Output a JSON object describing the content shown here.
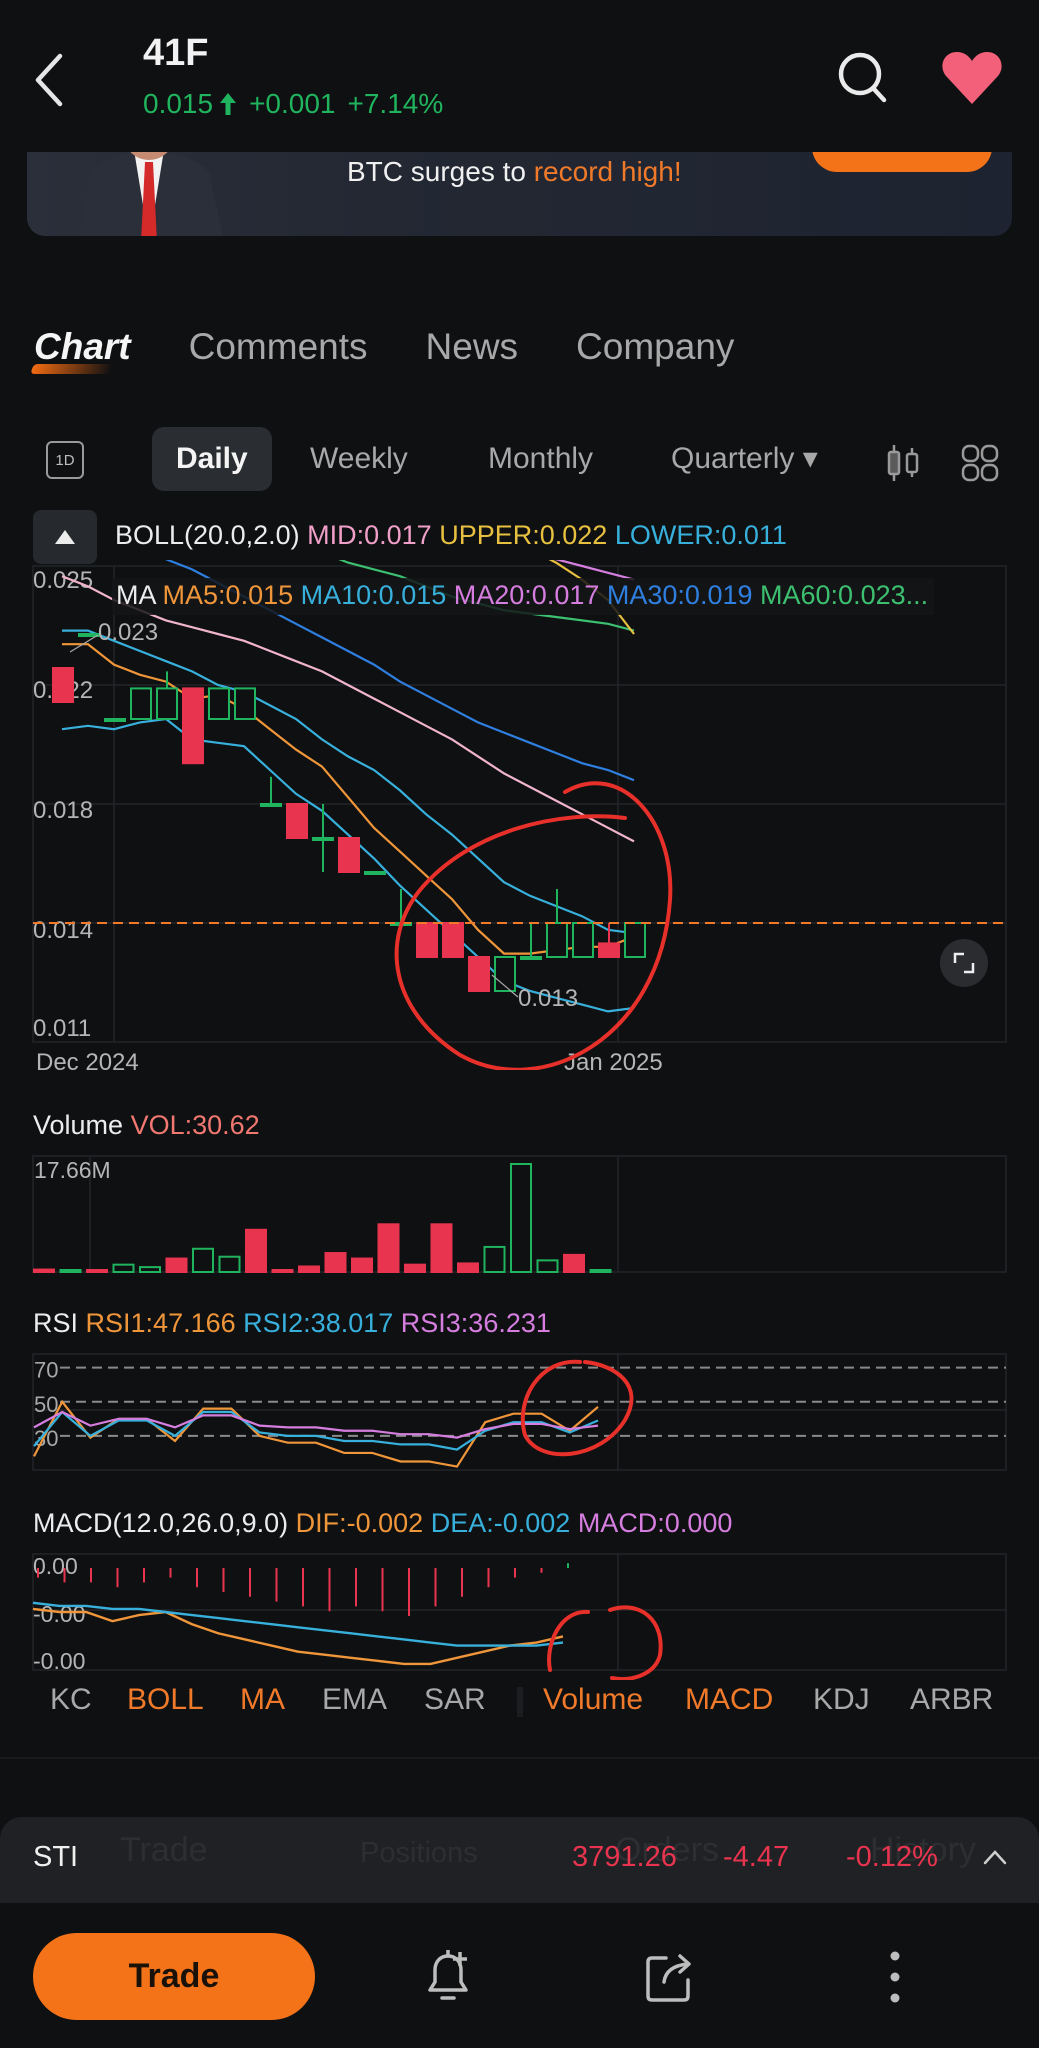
{
  "header": {
    "ticker": "41F",
    "price": "0.015",
    "direction_icon": "arrow-up-icon",
    "change": "+0.001",
    "change_pct": "+7.14%",
    "up_color": "#1fb45d",
    "favorite_color": "#f2607a"
  },
  "banner": {
    "text_plain": "BTC surges to ",
    "text_highlight": "record high!",
    "highlight_color": "#f07a2a"
  },
  "tabs": [
    {
      "label": "Chart",
      "active": true
    },
    {
      "label": "Comments",
      "active": false
    },
    {
      "label": "News",
      "active": false
    },
    {
      "label": "Company",
      "active": false
    }
  ],
  "periods": {
    "intraday_icon_label": "1D",
    "items": [
      {
        "label": "Daily",
        "active": true
      },
      {
        "label": "Weekly",
        "active": false
      },
      {
        "label": "Monthly",
        "active": false
      },
      {
        "label": "Quarterly ▾",
        "active": false
      }
    ]
  },
  "legends": {
    "boll": {
      "name": "BOLL(20.0,2.0)",
      "mid": "MID:0.017",
      "upper": "UPPER:0.022",
      "lower": "LOWER:0.011"
    },
    "ma": {
      "name": "MA",
      "ma5": "MA5:0.015",
      "ma10": "MA10:0.015",
      "ma20": "MA20:0.017",
      "ma30": "MA30:0.019",
      "ma60": "MA60:0.023..."
    },
    "volume": {
      "name": "Volume",
      "vol": "VOL:30.62"
    },
    "rsi": {
      "name": "RSI",
      "rsi1": "RSI1:47.166",
      "rsi2": "RSI2:38.017",
      "rsi3": "RSI3:36.231"
    },
    "macd": {
      "name": "MACD(12.0,26.0,9.0)",
      "dif": "DIF:-0.002",
      "dea": "DEA:-0.002",
      "macd": "MACD:0.000"
    }
  },
  "colors": {
    "up": "#1fb45d",
    "down": "#e8344e",
    "ma5": "#f0963a",
    "ma10": "#38b0dc",
    "ma20": "#d67ee0",
    "ma30": "#2f7fe0",
    "ma60": "#3cc070",
    "boll_mid": "#f0b4cc",
    "boll_upper": "#e8c040",
    "boll_lower": "#38b0dc",
    "last_price_line": "#f07a2a",
    "annotation": "#e8302a"
  },
  "chart_data": [
    {
      "type": "candlestick",
      "title": "41F Daily",
      "y_ticks": [
        "0.025",
        "0.022",
        "0.018",
        "0.014",
        "0.011"
      ],
      "ylim": [
        0.011,
        0.025
      ],
      "x_labels": [
        "Dec 2024",
        "Jan 2025"
      ],
      "high_label": "0.023",
      "low_label": "0.013",
      "last_price": 0.0145,
      "candles": [
        {
          "o": 0.022,
          "h": 0.022,
          "l": 0.021,
          "c": 0.021
        },
        {
          "o": 0.023,
          "h": 0.023,
          "l": 0.023,
          "c": 0.023
        },
        {
          "o": 0.0205,
          "h": 0.0205,
          "l": 0.0205,
          "c": 0.0205
        },
        {
          "o": 0.0205,
          "h": 0.0214,
          "l": 0.0205,
          "c": 0.0214
        },
        {
          "o": 0.0205,
          "h": 0.0219,
          "l": 0.0205,
          "c": 0.0214
        },
        {
          "o": 0.0214,
          "h": 0.0214,
          "l": 0.0192,
          "c": 0.0192
        },
        {
          "o": 0.0205,
          "h": 0.0214,
          "l": 0.0205,
          "c": 0.0214
        },
        {
          "o": 0.0205,
          "h": 0.0214,
          "l": 0.0205,
          "c": 0.0214
        },
        {
          "o": 0.018,
          "h": 0.0188,
          "l": 0.018,
          "c": 0.018
        },
        {
          "o": 0.018,
          "h": 0.018,
          "l": 0.017,
          "c": 0.017
        },
        {
          "o": 0.017,
          "h": 0.018,
          "l": 0.016,
          "c": 0.017
        },
        {
          "o": 0.017,
          "h": 0.017,
          "l": 0.016,
          "c": 0.016
        },
        {
          "o": 0.016,
          "h": 0.016,
          "l": 0.016,
          "c": 0.016
        },
        {
          "o": 0.0145,
          "h": 0.0155,
          "l": 0.0145,
          "c": 0.0145
        },
        {
          "o": 0.0145,
          "h": 0.0145,
          "l": 0.0135,
          "c": 0.0135
        },
        {
          "o": 0.0145,
          "h": 0.0145,
          "l": 0.0135,
          "c": 0.0135
        },
        {
          "o": 0.0135,
          "h": 0.0135,
          "l": 0.0125,
          "c": 0.0125
        },
        {
          "o": 0.0125,
          "h": 0.0135,
          "l": 0.0125,
          "c": 0.0135
        },
        {
          "o": 0.0135,
          "h": 0.0145,
          "l": 0.0135,
          "c": 0.0135
        },
        {
          "o": 0.0135,
          "h": 0.0155,
          "l": 0.0135,
          "c": 0.0145
        },
        {
          "o": 0.0135,
          "h": 0.0145,
          "l": 0.0135,
          "c": 0.0145
        },
        {
          "o": 0.0139,
          "h": 0.0145,
          "l": 0.0135,
          "c": 0.0135
        },
        {
          "o": 0.0135,
          "h": 0.0145,
          "l": 0.0135,
          "c": 0.0145
        }
      ],
      "series": [
        {
          "name": "MA5",
          "color_key": "ma5",
          "values": [
            0.0227,
            0.0227,
            0.0221,
            0.0218,
            0.0216,
            0.0211,
            0.0212,
            0.0208,
            0.0202,
            0.0196,
            0.0191,
            0.0182,
            0.0173,
            0.0166,
            0.0159,
            0.0152,
            0.0143,
            0.0136,
            0.0136,
            0.0137,
            0.0138,
            0.0138,
            0.0141
          ]
        },
        {
          "name": "BOLL-UPPER-MA10",
          "color_key": "ma10",
          "values": [
            0.0231,
            0.0231,
            0.0228,
            0.0225,
            0.0222,
            0.0219,
            0.0215,
            0.0213,
            0.0209,
            0.0205,
            0.0199,
            0.0194,
            0.019,
            0.0184,
            0.0177,
            0.0171,
            0.0164,
            0.0157,
            0.0153,
            0.015,
            0.0147,
            0.0143,
            0.0142
          ]
        },
        {
          "name": "BOLL-LOWER",
          "color_key": "boll_lower",
          "values": [
            0.0202,
            0.0203,
            0.0202,
            0.0204,
            0.0205,
            0.0199,
            0.0198,
            0.0197,
            0.019,
            0.0183,
            0.0178,
            0.0171,
            0.0164,
            0.0156,
            0.0149,
            0.0142,
            0.0135,
            0.0128,
            0.0125,
            0.0123,
            0.0121,
            0.0119,
            0.012
          ]
        },
        {
          "name": "BOLL-MID",
          "color_key": "boll_mid",
          "values": [
            0.0247,
            0.0244,
            0.024,
            0.0237,
            0.0234,
            0.0232,
            0.023,
            0.0228,
            0.0225,
            0.0222,
            0.0219,
            0.0215,
            0.0211,
            0.0207,
            0.0203,
            0.0199,
            0.0194,
            0.0189,
            0.0185,
            0.0181,
            0.0177,
            0.0173,
            0.0169
          ]
        },
        {
          "name": "MA30",
          "color_key": "ma30",
          "values": [
            null,
            null,
            null,
            null,
            0.0252,
            0.0249,
            0.0245,
            0.0241,
            0.0237,
            0.0233,
            0.0229,
            0.0225,
            0.0221,
            0.0216,
            0.0212,
            0.0208,
            0.0204,
            0.0201,
            0.0198,
            0.0195,
            0.0192,
            0.019,
            0.0187
          ]
        },
        {
          "name": "MA60",
          "color_key": "ma60",
          "values": [
            null,
            null,
            null,
            null,
            null,
            null,
            null,
            null,
            null,
            null,
            0.0254,
            0.0251,
            0.0249,
            0.0247,
            0.0244,
            0.0241,
            0.0239,
            0.0237,
            0.0236,
            0.0235,
            0.0234,
            0.0233,
            0.0231
          ]
        },
        {
          "name": "BOLL-UPPER",
          "color_key": "boll_upper",
          "values": [
            null,
            null,
            null,
            null,
            null,
            null,
            null,
            null,
            null,
            null,
            null,
            null,
            null,
            null,
            null,
            null,
            null,
            null,
            0.0255,
            0.0251,
            0.0246,
            0.024,
            0.023
          ]
        },
        {
          "name": "MA20",
          "color_key": "ma20",
          "values": [
            null,
            null,
            null,
            null,
            null,
            null,
            null,
            null,
            null,
            null,
            null,
            null,
            null,
            null,
            null,
            null,
            null,
            null,
            0.0254,
            0.0252,
            0.025,
            0.0248,
            0.0246
          ]
        }
      ]
    },
    {
      "type": "bar",
      "title": "Volume",
      "y_max_label": "17.66M",
      "ylim": [
        0,
        17.66
      ],
      "values": [
        0.4,
        0.3,
        0.1,
        1.2,
        0.8,
        2.2,
        3.8,
        2.5,
        6.9,
        0.3,
        0.9,
        3.1,
        2.2,
        7.8,
        1.2,
        7.8,
        1.4,
        4.1,
        17.66,
        1.9,
        2.8,
        0.3
      ],
      "up": [
        false,
        true,
        false,
        true,
        true,
        false,
        true,
        true,
        false,
        false,
        false,
        false,
        false,
        false,
        false,
        false,
        false,
        true,
        true,
        true,
        false,
        true
      ]
    },
    {
      "type": "line",
      "title": "RSI",
      "y_ticks": [
        "70",
        "50",
        "30"
      ],
      "ylim": [
        10,
        78
      ],
      "series": [
        {
          "name": "RSI1",
          "color_key": "ma5",
          "values": [
            18,
            50,
            29,
            40,
            40,
            27,
            46,
            46,
            30,
            26,
            26,
            20,
            20,
            15,
            15,
            12,
            38,
            43,
            43,
            33,
            47
          ]
        },
        {
          "name": "RSI2",
          "color_key": "ma10",
          "values": [
            24,
            44,
            30,
            39,
            39,
            30,
            44,
            44,
            32,
            30,
            30,
            27,
            27,
            25,
            25,
            22,
            33,
            38,
            38,
            32,
            39
          ]
        },
        {
          "name": "RSI3",
          "color_key": "ma20",
          "values": [
            35,
            44,
            36,
            40,
            40,
            35,
            42,
            42,
            36,
            35,
            35,
            33,
            33,
            31,
            31,
            29,
            34,
            37,
            37,
            34,
            36
          ]
        }
      ]
    },
    {
      "type": "line",
      "title": "MACD",
      "y_ticks": [
        "0.00",
        "-0.00",
        "-0.00"
      ],
      "ylim": [
        -0.0034,
        0.0004
      ],
      "histogram": [
        -0.0002,
        -0.0003,
        -0.0003,
        -0.0004,
        -0.0003,
        -0.0002,
        -0.0004,
        -0.0005,
        -0.0006,
        -0.0007,
        -0.0008,
        -0.0009,
        -0.0008,
        -0.0009,
        -0.001,
        -0.0008,
        -0.0006,
        -0.0004,
        -0.0002,
        -0.0001,
        0.0001
      ],
      "series": [
        {
          "name": "DIF",
          "color_key": "ma5",
          "values": [
            -0.0014,
            -0.0015,
            -0.0015,
            -0.0018,
            -0.0016,
            -0.0015,
            -0.0019,
            -0.0022,
            -0.0024,
            -0.0026,
            -0.0028,
            -0.0029,
            -0.003,
            -0.0031,
            -0.0032,
            -0.0032,
            -0.003,
            -0.0028,
            -0.0026,
            -0.0025,
            -0.0023
          ]
        },
        {
          "name": "DEA",
          "color_key": "ma10",
          "values": [
            -0.0012,
            -0.0013,
            -0.0013,
            -0.0014,
            -0.0014,
            -0.0015,
            -0.0016,
            -0.0017,
            -0.0018,
            -0.0019,
            -0.002,
            -0.0021,
            -0.0022,
            -0.0023,
            -0.0024,
            -0.0025,
            -0.0026,
            -0.0026,
            -0.0026,
            -0.0026,
            -0.0025
          ]
        }
      ]
    }
  ],
  "indicator_tabs": [
    {
      "label": "KC",
      "on": false
    },
    {
      "label": "BOLL",
      "on": true
    },
    {
      "label": "MA",
      "on": true
    },
    {
      "label": "EMA",
      "on": false
    },
    {
      "label": "SAR",
      "on": false
    },
    {
      "label": "Volume",
      "on": true
    },
    {
      "label": "MACD",
      "on": true
    },
    {
      "label": "KDJ",
      "on": false
    },
    {
      "label": "ARBR",
      "on": false
    }
  ],
  "index_bar": {
    "ghost_tabs": [
      "Trade",
      "Positions",
      "Orders",
      "History"
    ],
    "name": "STI",
    "price": "3791.26",
    "change": "-4.47",
    "change_pct": "-0.12%"
  },
  "toolbar": {
    "trade_label": "Trade"
  }
}
